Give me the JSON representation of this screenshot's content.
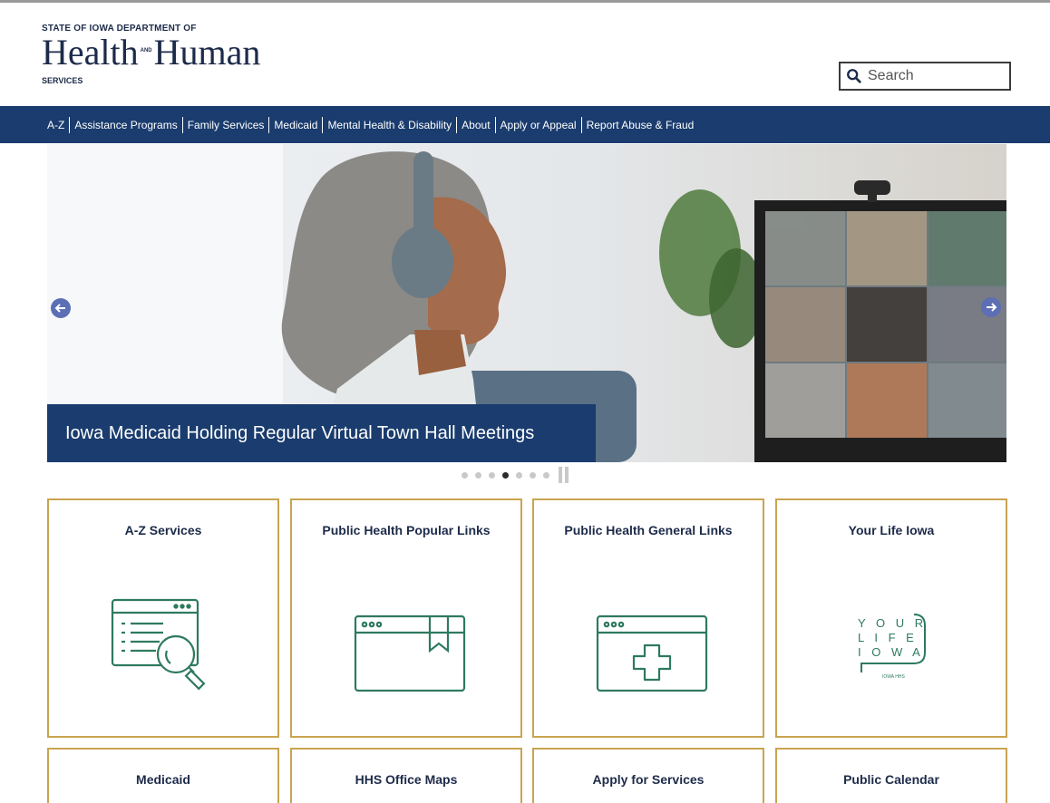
{
  "header": {
    "logo_top": "STATE OF IOWA DEPARTMENT OF",
    "logo_health": "Health",
    "logo_and": "AND",
    "logo_human": "Human",
    "logo_services": "SERVICES"
  },
  "search": {
    "placeholder": "Search"
  },
  "nav": {
    "items": [
      "A-Z",
      "Assistance Programs",
      "Family Services",
      "Medicaid",
      "Mental Health & Disability",
      "About",
      "Apply or Appeal",
      "Report Abuse & Fraud"
    ]
  },
  "carousel": {
    "caption": "Iowa Medicaid Holding Regular Virtual Town Hall Meetings",
    "slide_count": 7,
    "active_slide": 4
  },
  "cards": [
    {
      "title": "A-Z Services",
      "icon": "document-search-icon"
    },
    {
      "title": "Public Health Popular Links",
      "icon": "browser-bookmark-icon"
    },
    {
      "title": "Public Health General Links",
      "icon": "browser-medical-cross-icon"
    },
    {
      "title": "Your Life Iowa",
      "icon": "your-life-iowa-logo",
      "logo_lines": [
        "Y O U R",
        "L I F E",
        "I O W A"
      ],
      "logo_sub": "IOWA HHS"
    },
    {
      "title": "Medicaid"
    },
    {
      "title": "HHS Office Maps"
    },
    {
      "title": "Apply for Services"
    },
    {
      "title": "Public Calendar"
    }
  ],
  "colors": {
    "navy": "#1a3c6e",
    "card_border": "#c9a451",
    "icon_green": "#2e7a5e",
    "arrow_blue": "#5c6fb5"
  }
}
